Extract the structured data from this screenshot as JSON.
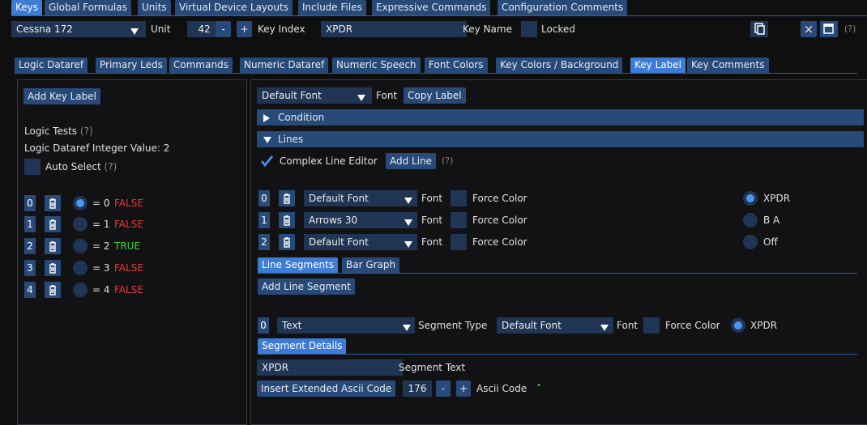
{
  "top_tabs": [
    "Keys",
    "Global Formulas",
    "Units",
    "Virtual Device Layouts",
    "Include Files",
    "Expressive Commands",
    "Configuration Comments"
  ],
  "toolbar": {
    "aircraft": "Cessna 172",
    "unit_label": "Unit",
    "unit_value": "42",
    "minus": "-",
    "plus": "+",
    "key_index_label": "Key Index",
    "key_name_value": "XPDR",
    "key_name_label": "Key Name",
    "locked_label": "Locked",
    "close": "×",
    "help": "(?)"
  },
  "sub_tabs": [
    "Logic Dataref",
    "Primary Leds",
    "Commands",
    "Numeric Dataref",
    "Numeric Speech",
    "Font Colors",
    "Key Colors / Background",
    "Key Label",
    "Key Comments"
  ],
  "left": {
    "add_key_label": "Add Key Label",
    "logic_tests": "Logic Tests",
    "help": "(?)",
    "logic_value": "Logic Dataref Integer Value: 2",
    "auto_select": "Auto Select",
    "rows": [
      {
        "idx": "0",
        "eq": "= 0",
        "result": "FALSE",
        "state": "false",
        "selected": true
      },
      {
        "idx": "1",
        "eq": "= 1",
        "result": "FALSE",
        "state": "false",
        "selected": false
      },
      {
        "idx": "2",
        "eq": "= 2",
        "result": "TRUE",
        "state": "true",
        "selected": false
      },
      {
        "idx": "3",
        "eq": "= 3",
        "result": "FALSE",
        "state": "false",
        "selected": false
      },
      {
        "idx": "4",
        "eq": "= 4",
        "result": "FALSE",
        "state": "false",
        "selected": false
      }
    ]
  },
  "right": {
    "font_select": "Default Font",
    "font_label": "Font",
    "copy_label": "Copy Label",
    "condition_header": "Condition",
    "lines_header": "Lines",
    "complex_line_editor": "Complex Line Editor",
    "add_line": "Add Line",
    "help": "(?)",
    "force_color": "Force Color",
    "lines": [
      {
        "idx": "0",
        "font": "Default Font",
        "option": "XPDR",
        "selected": true
      },
      {
        "idx": "1",
        "font": "Arrows 30",
        "option": "B A",
        "selected": false
      },
      {
        "idx": "2",
        "font": "Default Font",
        "option": "Off",
        "selected": false
      }
    ],
    "seg_tabs": [
      "Line Segments",
      "Bar Graph"
    ],
    "add_line_segment": "Add Line Segment",
    "segment": {
      "idx": "0",
      "type_value": "Text",
      "type_label": "Segment Type",
      "font_value": "Default Font",
      "font_label": "Font",
      "force_color": "Force Color",
      "option": "XPDR"
    },
    "segment_details_tab": "Segment Details",
    "segment_text_value": "XPDR",
    "segment_text_label": "Segment Text",
    "insert_ascii": "Insert Extended Ascii Code",
    "ascii_value": "176",
    "ascii_label": "Ascii Code",
    "ascii_marker": "•"
  },
  "colors": {
    "accent": "#3d7cd4",
    "tab": "#284a78",
    "field": "#1f3553",
    "false": "#e23b3b",
    "true": "#3ed23e"
  }
}
